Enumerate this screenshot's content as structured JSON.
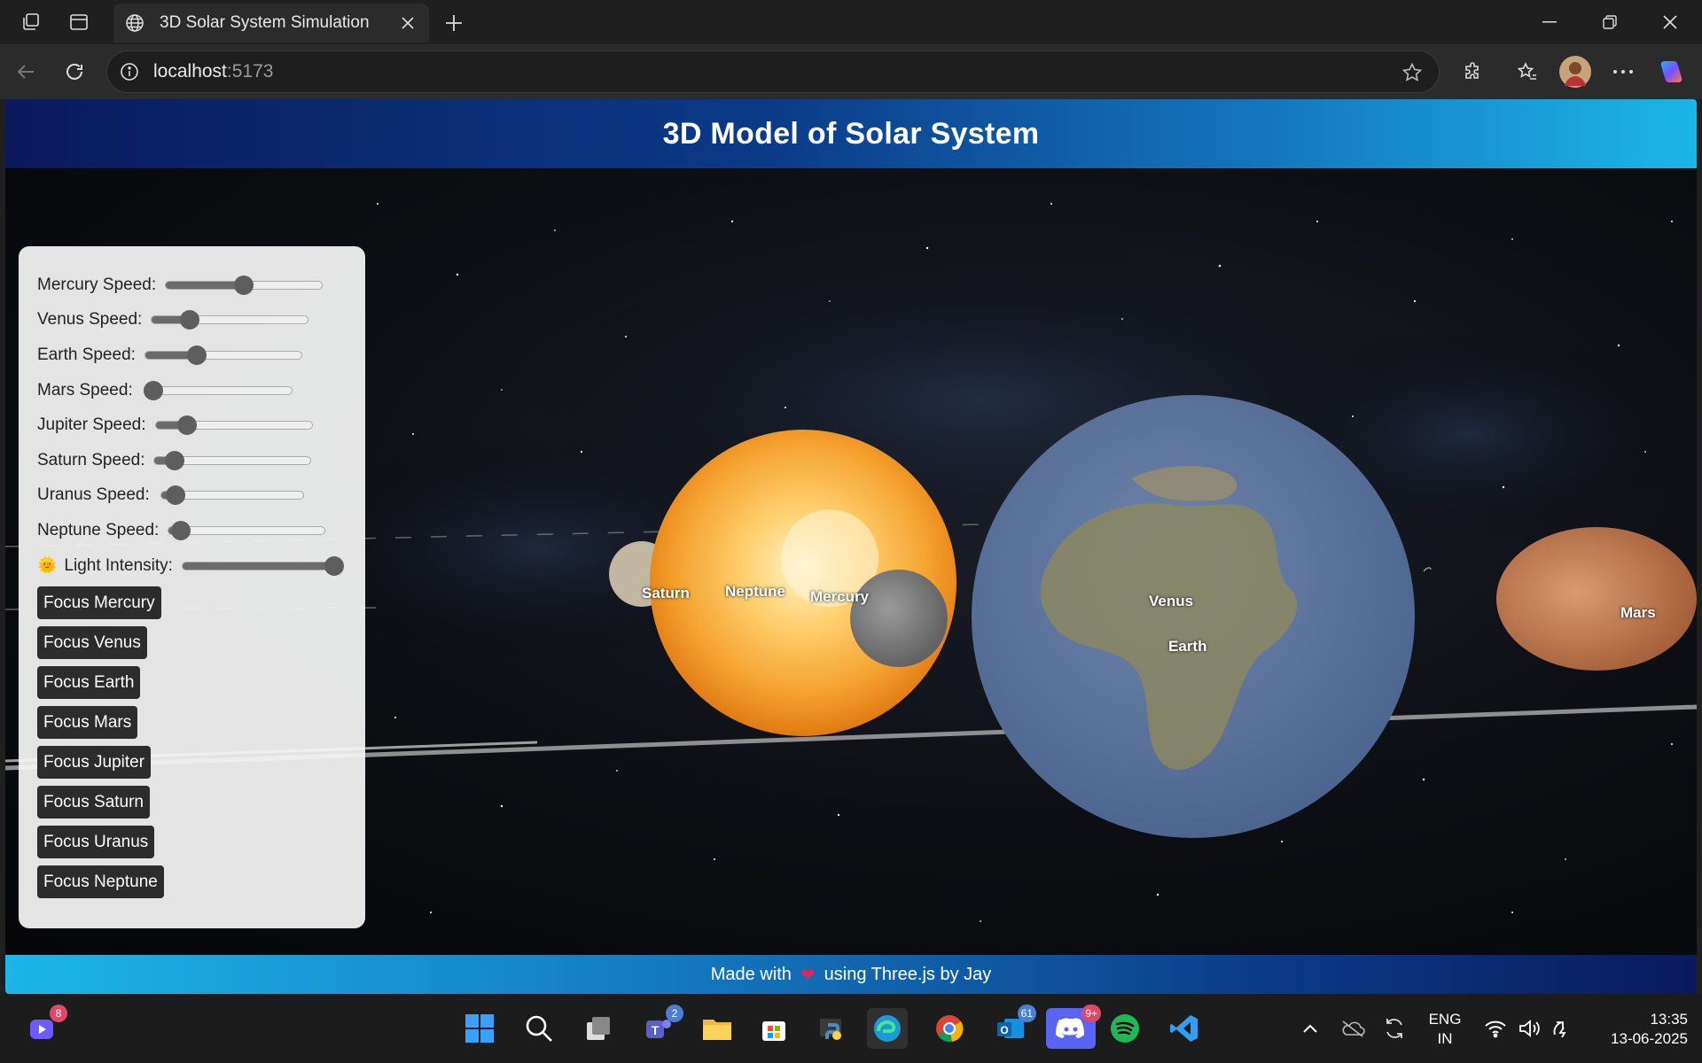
{
  "browser": {
    "tab_title": "3D Solar System Simulation",
    "url_host": "localhost",
    "url_port": ":5173"
  },
  "app": {
    "title": "3D Model of Solar System",
    "footer_pre": "Made with",
    "footer_post": "using Three.js by Jay"
  },
  "controls": {
    "sliders": [
      {
        "label": "Mercury Speed:",
        "value": 0.5
      },
      {
        "label": "Venus Speed:",
        "value": 0.24
      },
      {
        "label": "Earth Speed:",
        "value": 0.33
      },
      {
        "label": "Mars Speed:",
        "value": 0.05
      },
      {
        "label": "Jupiter Speed:",
        "value": 0.2
      },
      {
        "label": "Saturn Speed:",
        "value": 0.13
      },
      {
        "label": "Uranus Speed:",
        "value": 0.1
      },
      {
        "label": "Neptune Speed:",
        "value": 0.08
      },
      {
        "label": "Light Intensity:",
        "value": 0.97,
        "emoji": "🌞"
      }
    ],
    "buttons": [
      "Focus Mercury",
      "Focus Venus",
      "Focus Earth",
      "Focus Mars",
      "Focus Jupiter",
      "Focus Saturn",
      "Focus Uranus",
      "Focus Neptune"
    ]
  },
  "scene_labels": {
    "saturn": "Saturn",
    "neptune": "Neptune",
    "mercury": "Mercury",
    "venus": "Venus",
    "earth": "Earth",
    "mars": "Mars"
  },
  "taskbar": {
    "badges": {
      "copilot": "8",
      "teams": "2",
      "outlook": "61",
      "discord": "9+"
    },
    "lang_top": "ENG",
    "lang_bottom": "IN",
    "time": "13:35",
    "date": "13-06-2025"
  }
}
